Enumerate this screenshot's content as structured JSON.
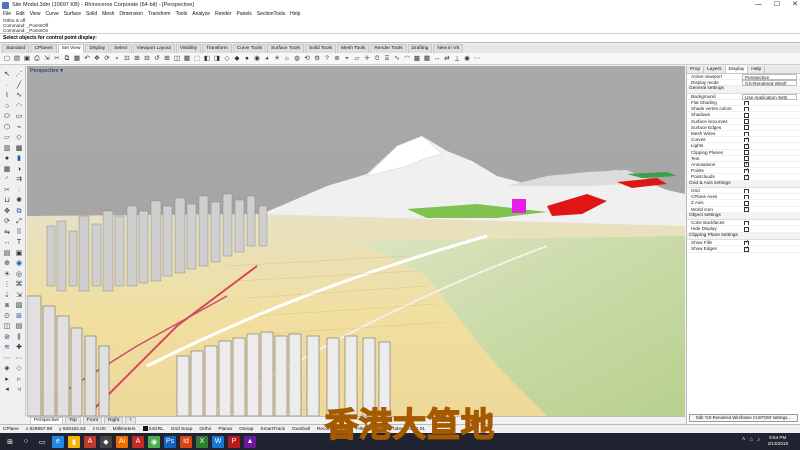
{
  "window": {
    "title": "Site Model.3dm (10697 KB) - Rhinoceros Corporate (64-bit) - [Perspective]",
    "controls": [
      "—",
      "☐",
      "✕"
    ]
  },
  "menu": [
    "File",
    "Edit",
    "View",
    "Curve",
    "Surface",
    "Solid",
    "Mesh",
    "Dimension",
    "Transform",
    "Tools",
    "Analyze",
    "Render",
    "Panels",
    "SectionTools",
    "Help"
  ],
  "command": {
    "history": [
      "Ortho is off",
      "Command: _PointsOff",
      "Command: _PointsOn"
    ],
    "prompt": "Select objects for control point display:"
  },
  "toolbar_tabs": {
    "items": [
      "Standard",
      "CPlanes",
      "Set View",
      "Display",
      "Select",
      "Viewport Layout",
      "Visibility",
      "Transform",
      "Curve Tools",
      "Surface Tools",
      "Solid Tools",
      "Mesh Tools",
      "Render Tools",
      "Drafting",
      "New in V5"
    ],
    "active": "Set View"
  },
  "viewport": {
    "label": "Perspective ▾",
    "tabs": [
      "Perspective",
      "Top",
      "Front",
      "Right",
      "+"
    ],
    "active_tab": "Perspective"
  },
  "watermark": "香港大笪地",
  "panel": {
    "tabs": [
      "Prop",
      "Layers",
      "Display",
      "Help"
    ],
    "active_tab": "Display",
    "rows": [
      {
        "k": "Active viewport",
        "v": "Perspective"
      },
      {
        "k": "Display mode",
        "v": "GS-Rendered Wirefr"
      }
    ],
    "sections": [
      {
        "title": "General settings",
        "rows": [
          {
            "k": "Background",
            "v": "Use Application Setti",
            "type": "box"
          },
          {
            "k": "Flat Shading",
            "check": false
          },
          {
            "k": "Shade vertex colors",
            "check": false
          },
          {
            "k": "Shadows",
            "check": false
          },
          {
            "k": "Surface isocurves",
            "check": false
          },
          {
            "k": "Surface Edges",
            "check": false
          },
          {
            "k": "Mesh Wires",
            "check": false
          },
          {
            "k": "Curves",
            "check": true
          },
          {
            "k": "Lights",
            "check": true
          },
          {
            "k": "Clipping Planes",
            "check": false
          },
          {
            "k": "Text",
            "check": false
          },
          {
            "k": "Annotations",
            "check": true
          },
          {
            "k": "Points",
            "check": true
          },
          {
            "k": "Pointclouds",
            "check": true
          }
        ]
      },
      {
        "title": "Grid & Axis settings",
        "rows": [
          {
            "k": "Grid",
            "check": false
          },
          {
            "k": "CPlane Axes",
            "check": false
          },
          {
            "k": "Z Axis",
            "check": false
          },
          {
            "k": "World Icon",
            "check": true
          }
        ]
      },
      {
        "title": "Object settings",
        "rows": [
          {
            "k": "Color Backfaces",
            "check": false
          },
          {
            "k": "Hide Display",
            "check": false
          }
        ]
      },
      {
        "title": "Clipping Plane settings",
        "rows": [
          {
            "k": "Show Fills",
            "check": true
          },
          {
            "k": "Show Edges",
            "check": true
          }
        ]
      }
    ],
    "footer": "Edit 'GS-Rendered Wireframe CUSTOM' settings..."
  },
  "status": {
    "cplane": "CPlane",
    "x": "x 829867.98",
    "y": "y 826182.63",
    "z": "z 0.00",
    "units": "Millimeters",
    "layer": "24GRL",
    "toggles": [
      "Grid Snap",
      "Ortho",
      "Planar",
      "Osnap",
      "SmartTrack",
      "Gumball",
      "Record History",
      "Filter"
    ],
    "message": "Absolute tolerance: 0.01"
  },
  "taskbar": {
    "time": "6:54 PM",
    "date": "2/13/2018"
  },
  "scene": {
    "sky": "#a6a6a6",
    "ground": "#f1dfa0",
    "accent_magenta": "#e61ee6",
    "accent_red": "#e01616"
  }
}
